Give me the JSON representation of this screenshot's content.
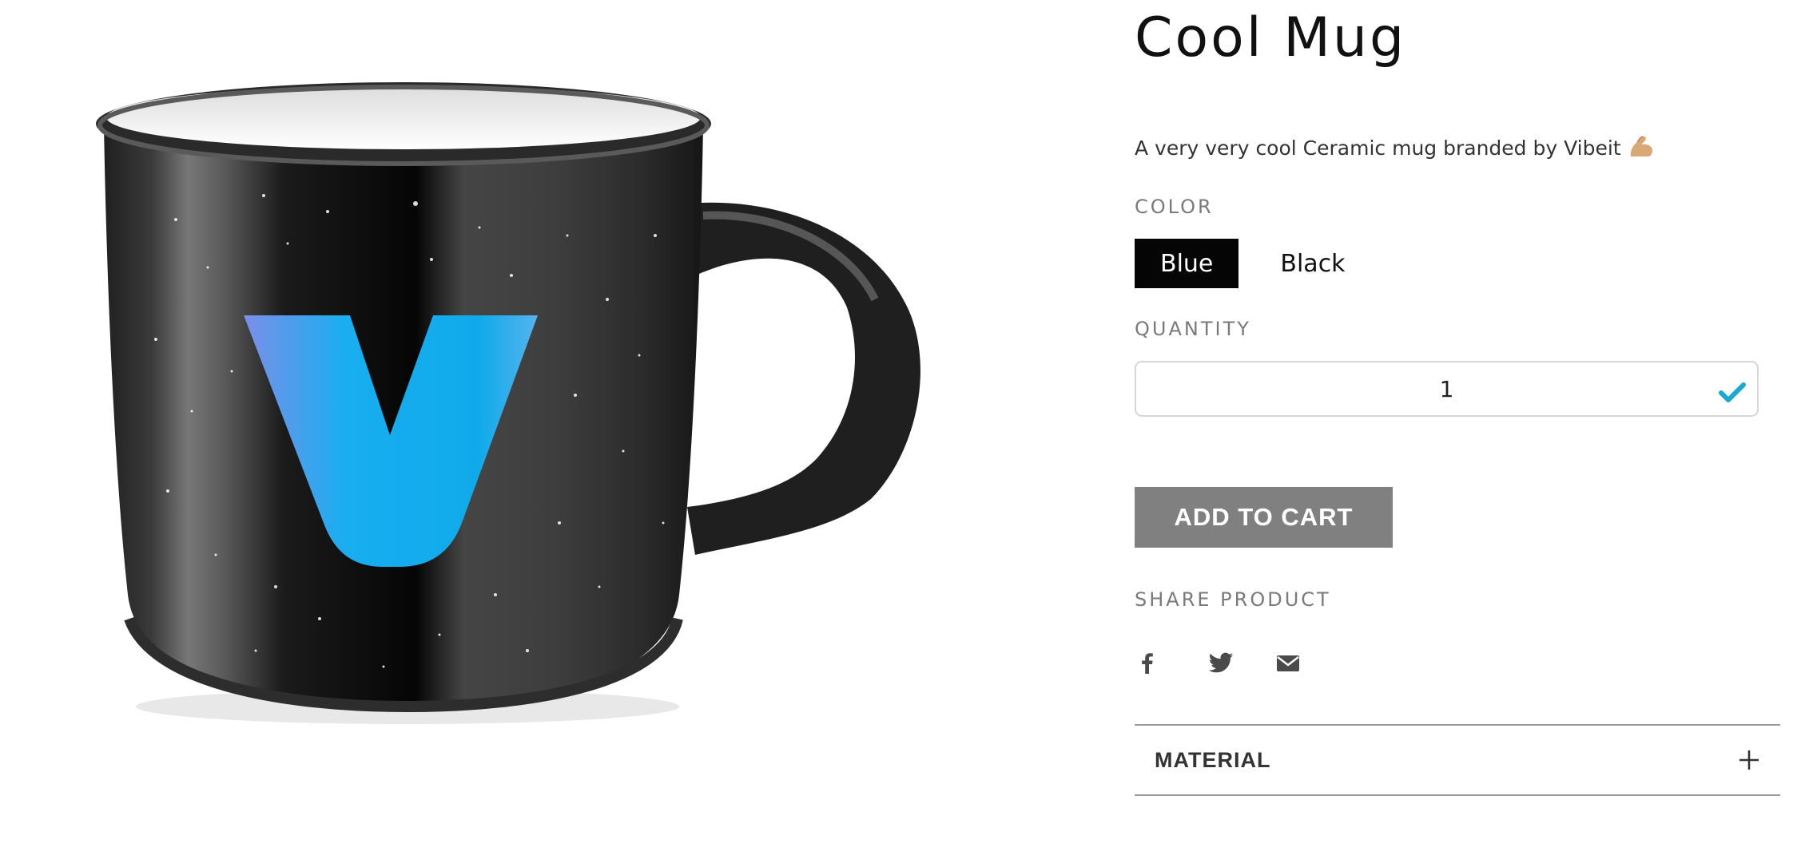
{
  "product": {
    "title": "Cool Mug",
    "description": "A very very cool Ceramic mug branded by Vibeit",
    "description_emoji": "flexed-biceps-icon",
    "image_alt": "black speckled ceramic mug with blue V logo"
  },
  "color": {
    "label": "COLOR",
    "options": [
      {
        "label": "Blue",
        "selected": true
      },
      {
        "label": "Black",
        "selected": false
      }
    ]
  },
  "quantity": {
    "label": "QUANTITY",
    "value": "1"
  },
  "cart": {
    "button_label": "ADD TO CART"
  },
  "share": {
    "label": "SHARE PRODUCT",
    "icons": [
      "facebook-icon",
      "twitter-icon",
      "email-icon"
    ]
  },
  "accordion": {
    "title": "MATERIAL"
  },
  "colors": {
    "accent_check": "#1aa8d0",
    "button_bg": "#808080",
    "selected_bg": "#050505",
    "logo_blue": "#12aae8"
  }
}
